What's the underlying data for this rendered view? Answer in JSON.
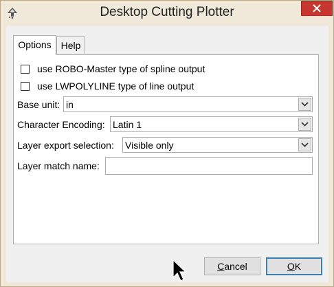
{
  "window": {
    "title": "Desktop Cutting Plotter",
    "close_icon": "close-icon",
    "app_icon": "inkscape-icon"
  },
  "tabs": [
    {
      "label": "Options",
      "active": true
    },
    {
      "label": "Help",
      "active": false
    }
  ],
  "options": {
    "roboMaster": {
      "label": "use ROBO-Master type of spline output",
      "checked": false
    },
    "lwpolyline": {
      "label": "use LWPOLYLINE type of line output",
      "checked": false
    },
    "baseUnit": {
      "label": "Base unit:",
      "value": "in"
    },
    "encoding": {
      "label": "Character Encoding:",
      "value": "Latin 1"
    },
    "layerExport": {
      "label": "Layer export selection:",
      "value": "Visible only"
    },
    "layerMatch": {
      "label": "Layer match name:",
      "value": ""
    }
  },
  "buttons": {
    "cancel": {
      "first": "C",
      "rest": "ancel"
    },
    "ok": {
      "first": "O",
      "rest": "K"
    }
  },
  "colors": {
    "frame": "#f0e8d8",
    "close": "#c7372f",
    "default_button_border": "#3c7fb1"
  }
}
